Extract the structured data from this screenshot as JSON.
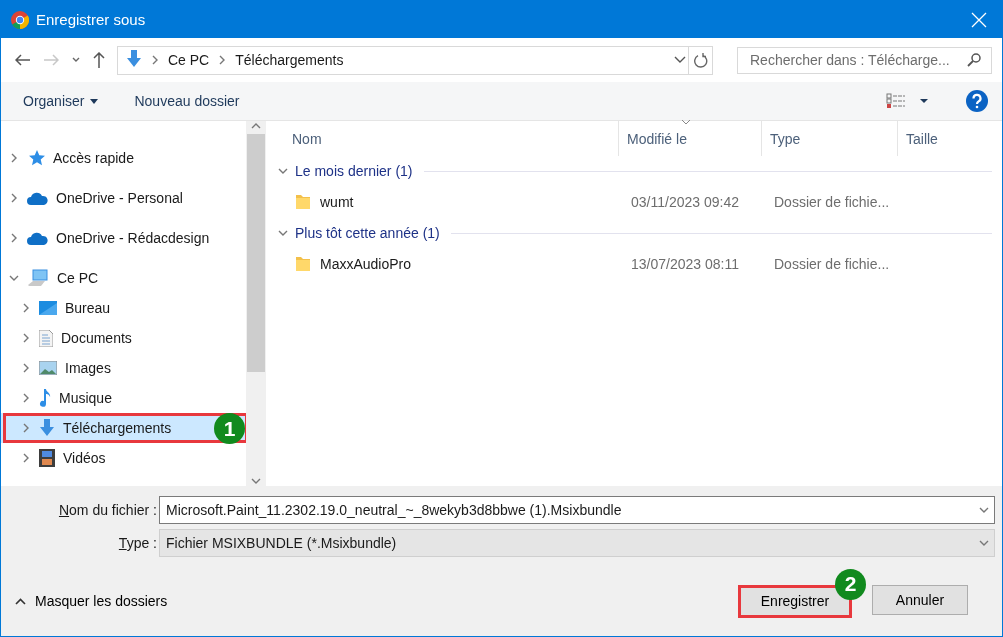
{
  "window": {
    "title": "Enregistrer sous"
  },
  "nav": {
    "path": [
      "Ce PC",
      "Téléchargements"
    ],
    "search": {
      "placeholder": "Rechercher dans : Télécharge..."
    }
  },
  "toolbar": {
    "organize": "Organiser",
    "new_folder": "Nouveau dossier"
  },
  "sidebar": {
    "items": [
      {
        "label": "Accès rapide",
        "kind": "star",
        "expanded": false,
        "selected": false
      },
      {
        "label": "OneDrive - Personal",
        "kind": "cloud",
        "expanded": false,
        "selected": false
      },
      {
        "label": "OneDrive - Rédacdesign",
        "kind": "cloud",
        "expanded": false,
        "selected": false
      },
      {
        "label": "Ce PC",
        "kind": "pc",
        "expanded": true,
        "selected": false,
        "children": [
          {
            "label": "Bureau",
            "kind": "desktop",
            "expanded": false,
            "selected": false
          },
          {
            "label": "Documents",
            "kind": "document",
            "expanded": false,
            "selected": false
          },
          {
            "label": "Images",
            "kind": "images",
            "expanded": false,
            "selected": false
          },
          {
            "label": "Musique",
            "kind": "music",
            "expanded": false,
            "selected": false
          },
          {
            "label": "Téléchargements",
            "kind": "download",
            "expanded": false,
            "selected": true,
            "callout": "1"
          },
          {
            "label": "Vidéos",
            "kind": "video",
            "expanded": false,
            "selected": false
          }
        ]
      }
    ]
  },
  "file_list": {
    "columns": [
      {
        "label": "Nom",
        "sorted": false
      },
      {
        "label": "Modifié le",
        "sorted": true
      },
      {
        "label": "Type",
        "sorted": false
      },
      {
        "label": "Taille",
        "sorted": false
      }
    ],
    "groups": [
      {
        "title": "Le mois dernier (1)",
        "rows": [
          {
            "name": "wumt",
            "modified": "03/11/2023 09:42",
            "type": "Dossier de fichie..."
          }
        ]
      },
      {
        "title": "Plus tôt cette année (1)",
        "rows": [
          {
            "name": "MaxxAudioPro",
            "modified": "13/07/2023 08:11",
            "type": "Dossier de fichie..."
          }
        ]
      }
    ]
  },
  "form": {
    "filename": {
      "label": "Nom du fichier :",
      "value": "Microsoft.Paint_11.2302.19.0_neutral_~_8wekyb3d8bbwe (1).Msixbundle"
    },
    "type": {
      "label": "Type :",
      "value": "Fichier MSIXBUNDLE (*.Msixbundle)"
    }
  },
  "footer": {
    "toggle": "Masquer les dossiers",
    "buttons": [
      {
        "label": "Enregistrer",
        "callout": "2"
      },
      {
        "label": "Annuler"
      }
    ]
  }
}
